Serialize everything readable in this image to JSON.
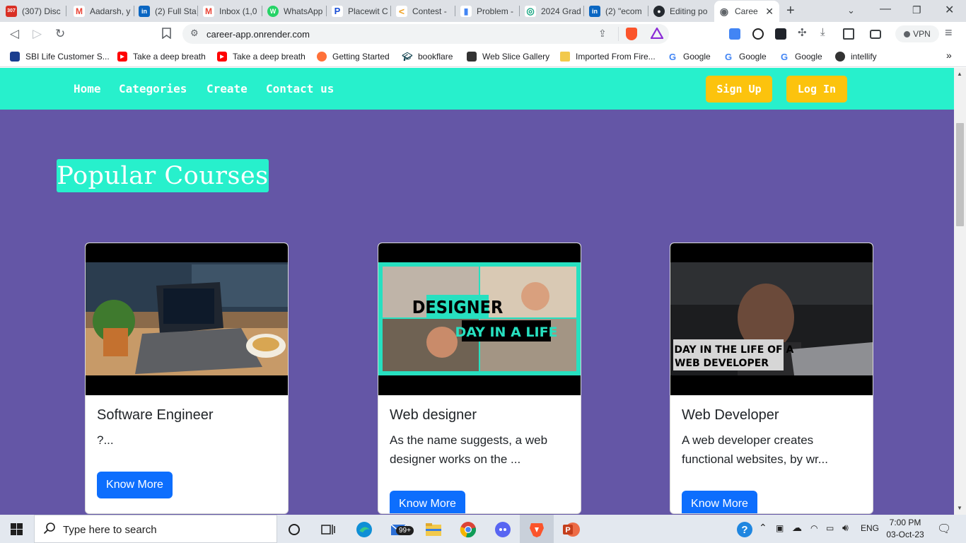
{
  "browser": {
    "tabs": [
      {
        "label": "(307) Disc",
        "favicon_text": "307",
        "color": "#d93025"
      },
      {
        "label": "Aadarsh, y",
        "favicon_text": "M",
        "color": "#ea4335"
      },
      {
        "label": "(2) Full Sta",
        "favicon_text": "in",
        "color": "#0a66c2"
      },
      {
        "label": "Inbox (1,0",
        "favicon_text": "M",
        "color": "#ea4335"
      },
      {
        "label": "WhatsApp",
        "favicon_text": "W",
        "color": "#25d366"
      },
      {
        "label": "Placewit C",
        "favicon_text": "P",
        "color": "#1a4fd6"
      },
      {
        "label": "Contest -",
        "favicon_text": "<",
        "color": "#f0a020"
      },
      {
        "label": "Problem -",
        "favicon_text": "▮",
        "color": "#4285f4"
      },
      {
        "label": "2024 Grad",
        "favicon_text": "◎",
        "color": "#10a37f"
      },
      {
        "label": "(2) \"ecom",
        "favicon_text": "in",
        "color": "#0a66c2"
      },
      {
        "label": "Editing po",
        "favicon_text": "●",
        "color": "#24292f"
      },
      {
        "label": "Caree",
        "favicon_text": "◉",
        "color": "#5f6368"
      }
    ],
    "url": "career-app.onrender.com",
    "vpn_label": "VPN",
    "bookmarks": [
      {
        "label": "SBI Life Customer S...",
        "icon": "sbi-icon",
        "color": "#1a3d8f"
      },
      {
        "label": "Take a deep breath",
        "icon": "youtube-icon",
        "color": "#ff0000"
      },
      {
        "label": "Take a deep breath",
        "icon": "youtube-icon",
        "color": "#ff0000"
      },
      {
        "label": "Getting Started",
        "icon": "firefox-icon",
        "color": "#ff7139"
      },
      {
        "label": "bookflare",
        "icon": "graduation-cap-icon",
        "color": "#0b3d4a"
      },
      {
        "label": "Web Slice Gallery",
        "icon": "slice-icon",
        "color": "#333333"
      },
      {
        "label": "Imported From Fire...",
        "icon": "folder-icon",
        "color": "#f2c94c"
      },
      {
        "label": "Google",
        "icon": "google-icon",
        "color": "#4285f4"
      },
      {
        "label": "Google",
        "icon": "google-icon",
        "color": "#4285f4"
      },
      {
        "label": "Google",
        "icon": "google-icon",
        "color": "#4285f4"
      },
      {
        "label": "intellify",
        "icon": "globe-icon",
        "color": "#333333"
      }
    ]
  },
  "site": {
    "nav": {
      "links": [
        "Home",
        "Categories",
        "Create",
        "Contact us"
      ],
      "signup": "Sign Up",
      "login": "Log In"
    },
    "heading": "Popular Courses",
    "colors": {
      "nav_bg": "#27f0cc",
      "page_bg": "#6456a6",
      "auth_btn": "#fcc30d",
      "primary_btn": "#0d6efd"
    },
    "cards": [
      {
        "title": "Software Engineer",
        "desc": "?...",
        "button": "Know More",
        "image": "laptop-cafe-photo"
      },
      {
        "title": "Web designer",
        "desc": "As the name suggests, a web designer works on the ...",
        "button": "Know More",
        "image": "designer-day-in-a-life-thumbnail",
        "thumb_line1": "DESIGNER",
        "thumb_line2": "DAY IN A LIFE"
      },
      {
        "title": "Web Developer",
        "desc": "A web developer creates functional websites, by wr...",
        "button": "Know More",
        "image": "web-developer-thumbnail",
        "thumb_line1": "A DAY IN THE LIFE OF A",
        "thumb_line2": "WEB DEVELOPER"
      }
    ]
  },
  "taskbar": {
    "search_placeholder": "Type here to search",
    "mail_badge": "99+",
    "language": "ENG",
    "time": "7:00 PM",
    "date": "03-Oct-23"
  }
}
